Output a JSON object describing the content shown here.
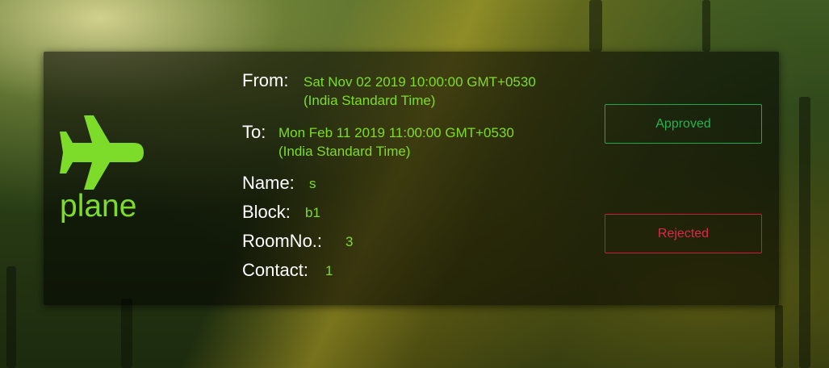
{
  "booking": {
    "vehicle_icon": "plane-icon",
    "vehicle_type": "plane",
    "from_label": "From:",
    "from_value_line1": "Sat Nov 02 2019 10:00:00 GMT+0530",
    "from_value_line2": "(India Standard Time)",
    "to_label": "To:",
    "to_value_line1": "Mon Feb 11 2019 11:00:00 GMT+0530",
    "to_value_line2": "(India Standard Time)",
    "name_label": "Name:",
    "name_value": "s",
    "block_label": "Block:",
    "block_value": "b1",
    "room_label": "RoomNo.:",
    "room_value": "3",
    "contact_label": "Contact:",
    "contact_value": "1"
  },
  "actions": {
    "approve_label": "Approved",
    "reject_label": "Rejected"
  },
  "colors": {
    "accent_green": "#7ddc2a",
    "approve_green": "#26b34f",
    "reject_red": "#e0264a"
  }
}
